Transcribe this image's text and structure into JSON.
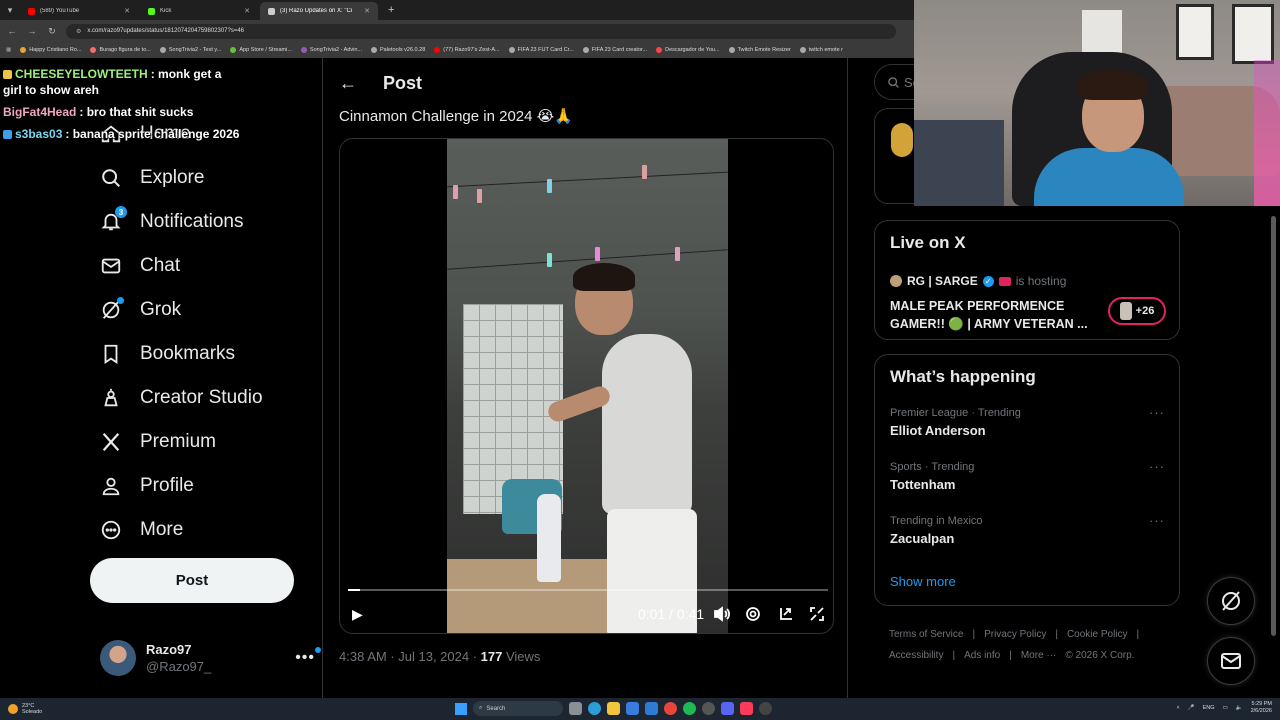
{
  "browser": {
    "tabs": [
      {
        "label": "(589) YouTube",
        "color": "#ff0000",
        "active": false
      },
      {
        "label": "Kick",
        "color": "#53fc18",
        "active": false
      },
      {
        "label": "(3) Razo Updates on X: \"Ci",
        "color": "#cccccc",
        "active": true
      }
    ],
    "url": "x.com/razo97updates/status/1812074204759802307?s=46",
    "bookmarks": [
      {
        "label": "Happy Cristiano Ro...",
        "color": "#e6a23c"
      },
      {
        "label": "Burago figura de to...",
        "color": "#f56c6c"
      },
      {
        "label": "SongTrivia2 - Test y...",
        "color": "#aaaaaa"
      },
      {
        "label": "App Store / Streami...",
        "color": "#67c23a"
      },
      {
        "label": "SongTrivia2 - Advin...",
        "color": "#9b59b6"
      },
      {
        "label": "Paletools v26.0.28",
        "color": "#aaaaaa"
      },
      {
        "label": "(77) Razo97's Zest-A...",
        "color": "#ff0000"
      },
      {
        "label": "FIFA 23 FUT Card Cr...",
        "color": "#aaaaaa"
      },
      {
        "label": "FIFA 23 Card creator...",
        "color": "#aaaaaa"
      },
      {
        "label": "Descargador de You...",
        "color": "#ff4444"
      },
      {
        "label": "Twitch Emote Resizer",
        "color": "#aaaaaa"
      },
      {
        "label": "twitch emote r",
        "color": "#aaaaaa"
      }
    ]
  },
  "chat": [
    {
      "user": "CHEESEYELOWTEETH",
      "text": ": monk get a girl to show areh",
      "user_color": "#9ef07a",
      "badge": "#e8c44a"
    },
    {
      "user": "BigFat4Head",
      "text": ": bro that shit sucks",
      "user_color": "#f0a8c0",
      "badge": ""
    },
    {
      "user": "s3bas03",
      "text": ": banana sprite challenge 2026",
      "user_color": "#7ad6f0",
      "badge": "#3ea0e8"
    }
  ],
  "nav": {
    "items": [
      {
        "label": "Home",
        "icon": "home-icon"
      },
      {
        "label": "Explore",
        "icon": "search-icon"
      },
      {
        "label": "Notifications",
        "icon": "bell-icon",
        "badge": "3"
      },
      {
        "label": "Chat",
        "icon": "mail-icon"
      },
      {
        "label": "Grok",
        "icon": "grok-icon"
      },
      {
        "label": "Bookmarks",
        "icon": "bookmark-icon"
      },
      {
        "label": "Creator Studio",
        "icon": "creator-studio-icon"
      },
      {
        "label": "Premium",
        "icon": "x-logo-icon"
      },
      {
        "label": "Profile",
        "icon": "person-icon"
      },
      {
        "label": "More",
        "icon": "more-circle-icon"
      }
    ],
    "post_button": "Post",
    "account": {
      "name": "Razo97",
      "handle": "@Razo97_",
      "more": "•••"
    }
  },
  "main": {
    "header_title": "Post",
    "post_text": "Cinnamon Challenge in 2024 😭🙏",
    "video": {
      "time": "0:01 / 0:41",
      "progress": 0.024
    },
    "meta": {
      "timestamp": "4:38 AM · Jul 13, 2024 · ",
      "views_count": "177",
      "views_label": " Views"
    }
  },
  "right": {
    "search_placeholder": "Se",
    "live": {
      "title": "Live on X",
      "host": "RG | SARGE",
      "host_suffix": "is hosting",
      "stream_title": "MALE PEAK PERFORMENCE GAMER!! 🟢 | ARMY VETERAN ...",
      "listeners": "+26"
    },
    "happening": {
      "title": "What’s happening",
      "trends": [
        {
          "meta": "Premier League · Trending",
          "name": "Elliot Anderson"
        },
        {
          "meta": "Sports · Trending",
          "name": "Tottenham"
        },
        {
          "meta": "Trending in Mexico",
          "name": "Zacualpan"
        }
      ],
      "show_more": "Show more"
    },
    "footer_links": [
      "Terms of Service",
      "|",
      "Privacy Policy",
      "|",
      "Cookie Policy",
      "|",
      "Accessibility",
      "|",
      "Ads info",
      "|",
      "More ···",
      "© 2026 X Corp."
    ]
  },
  "taskbar": {
    "weather_temp": "23°C",
    "weather_desc": "Soleado",
    "search": "Search",
    "lang": "ENG",
    "time": "5:29 PM",
    "date": "2/6/2026"
  }
}
